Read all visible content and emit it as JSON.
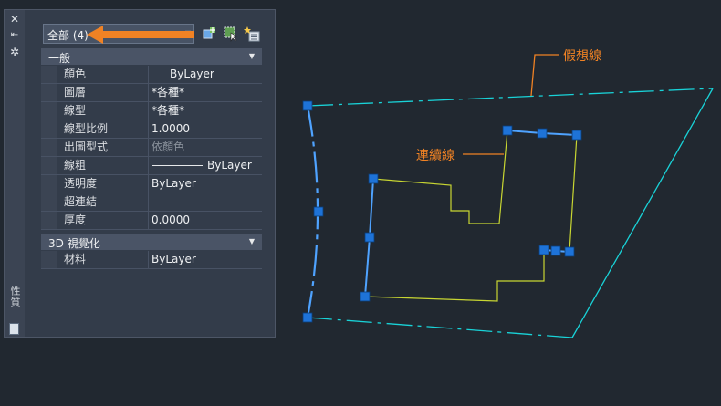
{
  "palette": {
    "title": "性質",
    "selection": "全部 (4)",
    "categories": [
      {
        "name": "一般",
        "rows": [
          {
            "key": "顏色",
            "value": "ByLayer"
          },
          {
            "key": "圖層",
            "value": "*各種*"
          },
          {
            "key": "線型",
            "value": "*各種*"
          },
          {
            "key": "線型比例",
            "value": "1.0000"
          },
          {
            "key": "出圖型式",
            "value": "依顏色"
          },
          {
            "key": "線粗",
            "value": "ByLayer"
          },
          {
            "key": "透明度",
            "value": "ByLayer"
          },
          {
            "key": "超連結",
            "value": ""
          },
          {
            "key": "厚度",
            "value": "0.0000"
          }
        ]
      },
      {
        "name": "3D 視覺化",
        "rows": [
          {
            "key": "材料",
            "value": "ByLayer"
          }
        ]
      }
    ]
  },
  "drawing": {
    "label_phantom": "假想線",
    "label_continuous": "連續線"
  },
  "colors": {
    "background": "#212830",
    "phantom_line": "#19d3d8",
    "continuous_line": "#c8d632",
    "grip": "#1e73d8",
    "callout": "#f08224"
  }
}
